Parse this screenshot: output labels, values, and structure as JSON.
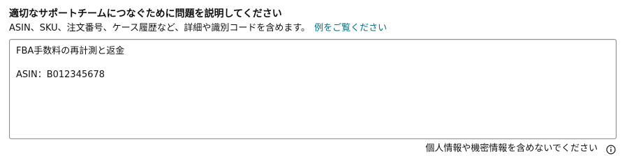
{
  "form": {
    "label": "適切なサポートチームにつなぐために問題を説明してください",
    "hint": "ASIN、SKU、注文番号、ケース履歴など、詳細や識別コードを含めます。",
    "example_link": "例をご覧ください",
    "description_value": "FBA手数料の再計測と返金\n\nASIN：B012345678",
    "privacy_note": "個人情報や機密情報を含めないでください",
    "info_icon": "info-circle-icon",
    "link_color": "#007185"
  }
}
